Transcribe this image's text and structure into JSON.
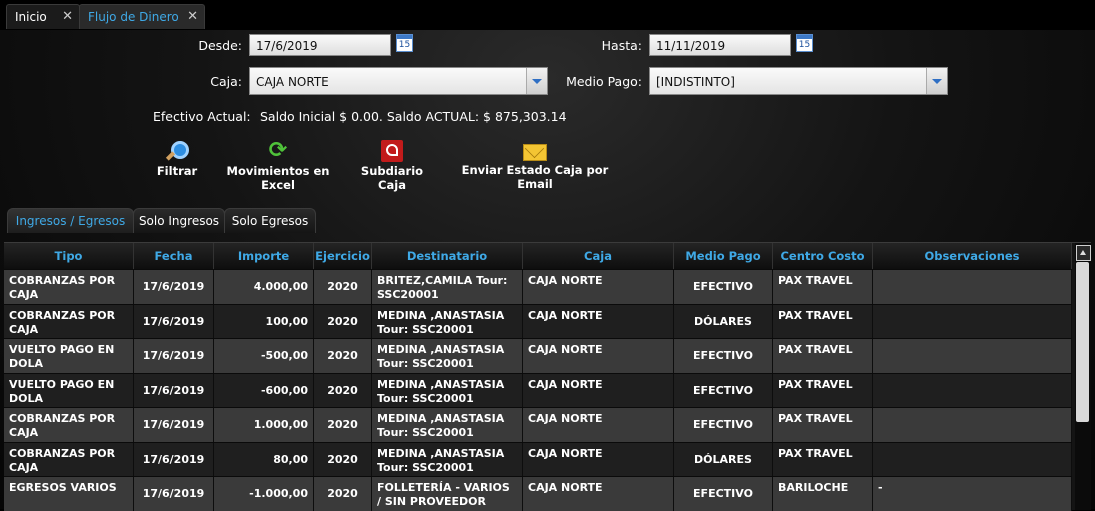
{
  "tabs": [
    {
      "label": "Inicio"
    },
    {
      "label": "Flujo de Dinero"
    }
  ],
  "filters": {
    "desde_label": "Desde:",
    "desde_value": "17/6/2019",
    "hasta_label": "Hasta:",
    "hasta_value": "11/11/2019",
    "caja_label": "Caja:",
    "caja_value": "CAJA NORTE",
    "medio_label": "Medio Pago:",
    "medio_value": "[INDISTINTO]",
    "calendar_icon_text": "15"
  },
  "saldo": {
    "label": "Efectivo Actual:",
    "value": "Saldo Inicial $ 0.00. Saldo ACTUAL:  $ 875,303.14"
  },
  "actions": [
    {
      "label": "Filtrar",
      "icon": "search-icon"
    },
    {
      "label": "Movimientos en Excel",
      "icon": "refresh-icon"
    },
    {
      "label": "Subdiario Caja",
      "icon": "pdf-icon"
    },
    {
      "label": "Enviar Estado Caja por Email",
      "icon": "mail-icon"
    }
  ],
  "subtabs": [
    "Ingresos / Egresos",
    "Solo Ingresos",
    "Solo Egresos"
  ],
  "grid": {
    "columns": [
      "Tipo",
      "Fecha",
      "Importe",
      "Ejercicio",
      "Destinatario",
      "Caja",
      "Medio Pago",
      "Centro Costo",
      "Observaciones"
    ],
    "rows": [
      {
        "tipo": "COBRANZAS POR CAJA",
        "fecha": "17/6/2019",
        "importe": "4.000,00",
        "ejercicio": "2020",
        "destinatario": "BRITEZ,CAMILA Tour: SSC20001",
        "caja": "CAJA NORTE",
        "medio": "EFECTIVO",
        "centro": "PAX TRAVEL",
        "obs": ""
      },
      {
        "tipo": "COBRANZAS POR CAJA",
        "fecha": "17/6/2019",
        "importe": "100,00",
        "ejercicio": "2020",
        "destinatario": "MEDINA ,ANASTASIA Tour: SSC20001",
        "caja": "CAJA NORTE",
        "medio": "DÓLARES",
        "centro": "PAX TRAVEL",
        "obs": ""
      },
      {
        "tipo": "VUELTO PAGO EN DOLA",
        "fecha": "17/6/2019",
        "importe": "-500,00",
        "ejercicio": "2020",
        "destinatario": "MEDINA ,ANASTASIA Tour: SSC20001",
        "caja": "CAJA NORTE",
        "medio": "EFECTIVO",
        "centro": "PAX TRAVEL",
        "obs": ""
      },
      {
        "tipo": "VUELTO PAGO EN DOLA",
        "fecha": "17/6/2019",
        "importe": "-600,00",
        "ejercicio": "2020",
        "destinatario": "MEDINA ,ANASTASIA Tour: SSC20001",
        "caja": "CAJA NORTE",
        "medio": "EFECTIVO",
        "centro": "PAX TRAVEL",
        "obs": ""
      },
      {
        "tipo": "COBRANZAS POR CAJA",
        "fecha": "17/6/2019",
        "importe": "1.000,00",
        "ejercicio": "2020",
        "destinatario": "MEDINA ,ANASTASIA Tour: SSC20001",
        "caja": "CAJA NORTE",
        "medio": "EFECTIVO",
        "centro": "PAX TRAVEL",
        "obs": ""
      },
      {
        "tipo": "COBRANZAS POR CAJA",
        "fecha": "17/6/2019",
        "importe": "80,00",
        "ejercicio": "2020",
        "destinatario": "MEDINA ,ANASTASIA Tour: SSC20001",
        "caja": "CAJA NORTE",
        "medio": "DÓLARES",
        "centro": "PAX TRAVEL",
        "obs": ""
      },
      {
        "tipo": "EGRESOS VARIOS",
        "fecha": "17/6/2019",
        "importe": "-1.000,00",
        "ejercicio": "2020",
        "destinatario": "FOLLETERÍA - VARIOS / SIN PROVEEDOR DEFINIDO",
        "caja": "CAJA NORTE",
        "medio": "EFECTIVO",
        "centro": "BARILOCHE",
        "obs": "-"
      }
    ]
  },
  "colors": {
    "accent": "#3fa9e6",
    "row_odd": "#3a3a3a",
    "row_even": "#1f1f1f"
  }
}
